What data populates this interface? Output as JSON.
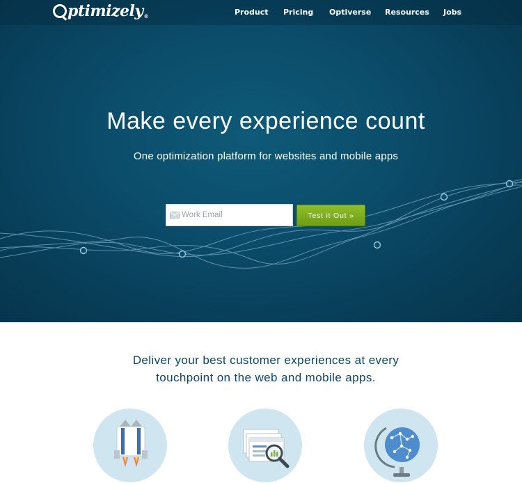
{
  "header": {
    "logo": "ptimizely",
    "nav": [
      "Product",
      "Pricing",
      "Optiverse",
      "Resources",
      "Jobs"
    ]
  },
  "hero": {
    "title": "Make every experience count",
    "subtitle": "One optimization platform for websites and mobile apps",
    "email_placeholder": "Work Email",
    "cta_label": "Test it Out »"
  },
  "section": {
    "tagline_line1": "Deliver your best customer experiences at every",
    "tagline_line2": "touchpoint on the web and mobile apps."
  },
  "features": [
    {
      "icon": "rocket-icon"
    },
    {
      "icon": "browser-windows-magnifier-icon"
    },
    {
      "icon": "globe-icon"
    }
  ],
  "colors": {
    "hero_bg": "#0b4d6b",
    "cta_green": "#7fae22",
    "tagline_blue": "#0d4664",
    "feature_circle": "#cfe6f1"
  }
}
